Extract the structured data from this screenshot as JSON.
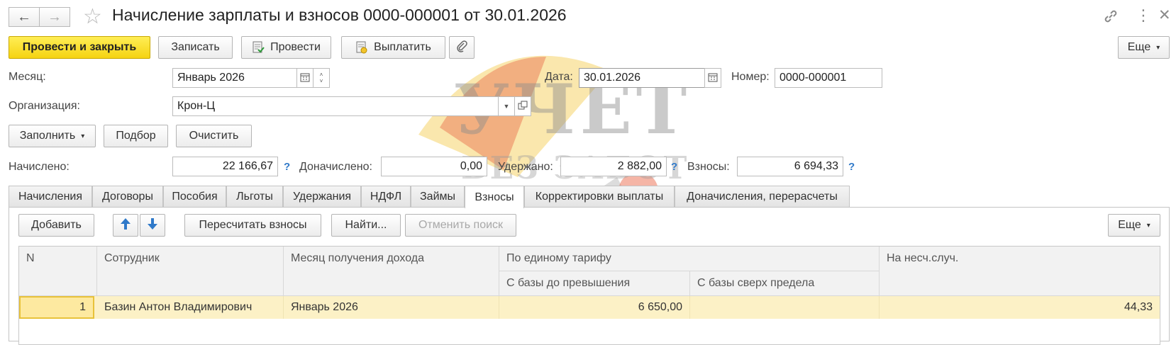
{
  "window": {
    "title": "Начисление зарплаты и взносов 0000-000001 от 30.01.2026"
  },
  "icons": {
    "back": "arrow-left-icon",
    "forward": "arrow-right-icon",
    "favorite": "star-icon",
    "link": "link-icon",
    "menu": "vertical-dots-icon"
  },
  "toolbar": {
    "post_and_close": "Провести и закрыть",
    "save": "Записать",
    "post": "Провести",
    "pay": "Выплатить",
    "more": "Еще"
  },
  "header": {
    "month_label": "Месяц:",
    "month_value": "Январь 2026",
    "date_label": "Дата:",
    "date_value": "30.01.2026",
    "number_label": "Номер:",
    "number_value": "0000-000001",
    "org_label": "Организация:",
    "org_value": "Крон-Ц"
  },
  "actions": {
    "fill": "Заполнить",
    "pick": "Подбор",
    "clear": "Очистить"
  },
  "totals": {
    "accrued_label": "Начислено:",
    "accrued_value": "22 166,67",
    "extra_label": "Доначислено:",
    "extra_value": "0,00",
    "withheld_label": "Удержано:",
    "withheld_value": "2 882,00",
    "contrib_label": "Взносы:",
    "contrib_value": "6 694,33",
    "help": "?"
  },
  "tabs": [
    {
      "label": "Начисления"
    },
    {
      "label": "Договоры"
    },
    {
      "label": "Пособия"
    },
    {
      "label": "Льготы"
    },
    {
      "label": "Удержания"
    },
    {
      "label": "НДФЛ"
    },
    {
      "label": "Займы"
    },
    {
      "label": "Взносы",
      "active": true
    },
    {
      "label": "Корректировки выплаты"
    },
    {
      "label": "Доначисления, перерасчеты"
    }
  ],
  "panel_toolbar": {
    "add": "Добавить",
    "recalc": "Пересчитать взносы",
    "find": "Найти...",
    "cancel_search": "Отменить поиск",
    "more": "Еще"
  },
  "table": {
    "columns": {
      "n": "N",
      "employee": "Сотрудник",
      "income_month": "Месяц получения дохода",
      "unified_tariff": "По единому тарифу",
      "base_below": "С базы до превышения",
      "base_above": "С базы сверх предела",
      "accident": "На несч.случ."
    },
    "rows": [
      {
        "n": "1",
        "employee": "Базин Антон Владимирович",
        "income_month": "Январь 2026",
        "base_below": "6 650,00",
        "base_above": "",
        "accident": "44,33"
      }
    ]
  },
  "watermark": {
    "line1": "УЧЕТ",
    "line2": "БЕЗ ЗАБОТ"
  },
  "colors": {
    "primary_button": "#f5d312",
    "selected_row": "#fcf1c6",
    "help_blue": "#2f79c9",
    "arrow_blue": "#2f79c9"
  }
}
